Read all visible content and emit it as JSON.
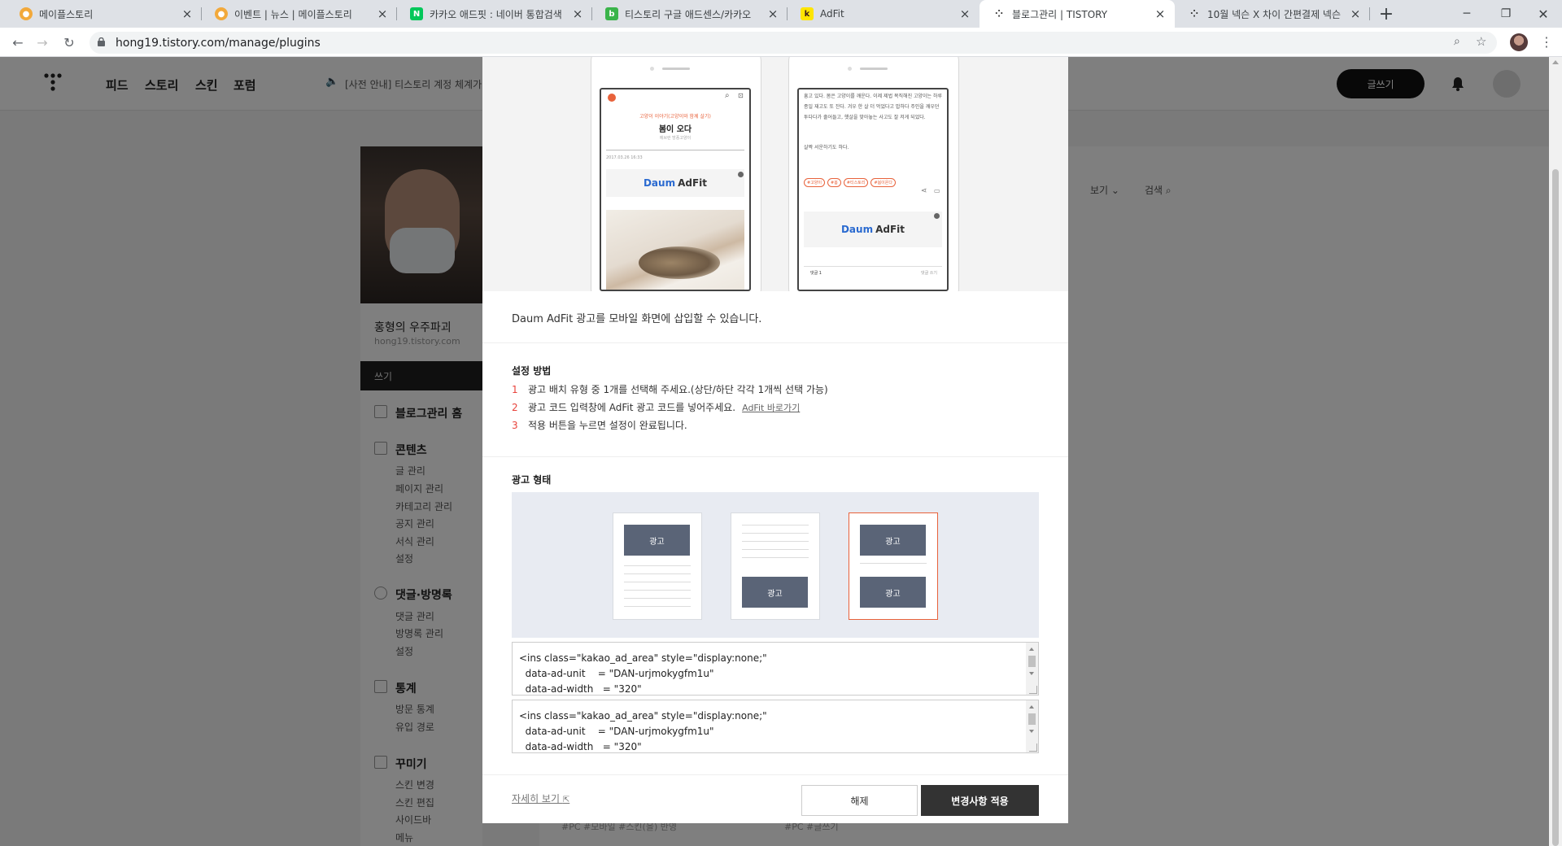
{
  "browser": {
    "tabs": [
      {
        "title": "메이플스토리",
        "favicon": "maple-icon"
      },
      {
        "title": "이벤트 | 뉴스 | 메이플스토리",
        "favicon": "maple-icon"
      },
      {
        "title": "카카오 애드핏 : 네이버 통합검색",
        "favicon": "naver-icon"
      },
      {
        "title": "티스토리 구글 애드센스/카카오",
        "favicon": "blog-icon"
      },
      {
        "title": "AdFit",
        "favicon": "kakao-icon"
      },
      {
        "title": "블로그관리 | TISTORY",
        "favicon": "tistory-icon"
      },
      {
        "title": "10월 넥슨 X 차이 간편결제 넥슨",
        "favicon": "tistory-icon"
      }
    ],
    "url": "hong19.tistory.com/manage/plugins"
  },
  "gnb": {
    "nav": [
      "피드",
      "스토리",
      "스킨",
      "포럼"
    ],
    "notice": "[사전 안내] 티스토리 계정 체계가 카",
    "write_button": "글쓰기"
  },
  "sidebar": {
    "blog_name": "홍형의 우주파괴",
    "blog_url": "hong19.tistory.com",
    "write": "쓰기",
    "home": "블로그관리 홈",
    "sections": [
      {
        "title": "콘텐츠",
        "items": [
          "글 관리",
          "페이지 관리",
          "카테고리 관리",
          "공지 관리",
          "서식 관리",
          "설정"
        ]
      },
      {
        "title": "댓글·방명록",
        "items": [
          "댓글 관리",
          "방명록 관리",
          "설정"
        ]
      },
      {
        "title": "통계",
        "items": [
          "방문 통계",
          "유입 경로"
        ]
      },
      {
        "title": "꾸미기",
        "items": [
          "스킨 변경",
          "스킨 편집",
          "사이드바",
          "메뉴"
        ]
      }
    ]
  },
  "content": {
    "view_label": "보기",
    "search_label": "검색",
    "card_tags": [
      "#PC  #모바일  #스킨(을) 반영",
      "#PC  #글쓰기"
    ]
  },
  "modal": {
    "preview": {
      "left_tagline": "고양이 이야기(고양이와 함께 살기)",
      "left_title": "봄이 오다",
      "left_sub": "에브런 방풍고양이",
      "left_date": "2017.03.26  16:33",
      "adfit_label": "AdFit",
      "right_text": "흥고 있다. 봄은 고양이를 깨운다. 이제 제법 목직해진 고양이는 하루 종일 재고도 또 잔다. 겨우 한 살 더 먹었다고 밥하다 주인을 깨우던 투다다가 줄어들고, 햇살을 맞아놓는 사고도 잘 저게 되었다.",
      "right_text2": "살짝 서운하기도 하다.",
      "right_tags": [
        "#고양이",
        "#봄",
        "#티스토리",
        "#봄이온다"
      ],
      "right_comment": "댓글 1",
      "right_comment_write": "댓글 쓰기"
    },
    "description": "Daum AdFit 광고를 모바일 화면에 삽입할 수 있습니다.",
    "setup_title": "설정 방법",
    "steps": [
      {
        "num": "1",
        "text": "광고 배치 유형 중 1개를 선택해 주세요.(상단/하단 각각 1개씩 선택 가능)"
      },
      {
        "num": "2",
        "text": "광고 코드 입력창에 AdFit 광고 코드를 넣어주세요.",
        "link": "AdFit 바로가기"
      },
      {
        "num": "3",
        "text": "적용 버튼을 누르면 설정이 완료됩니다."
      }
    ],
    "ad_type_title": "광고 형태",
    "ad_label": "광고",
    "selected_type": 3,
    "code_top": "<ins class=\"kakao_ad_area\" style=\"display:none;\"\n  data-ad-unit    = \"DAN-urjmokygfm1u\"\n  data-ad-width   = \"320\"",
    "code_bottom": "<ins class=\"kakao_ad_area\" style=\"display:none;\"\n  data-ad-unit    = \"DAN-urjmokygfm1u\"\n  data-ad-width   = \"320\"",
    "more_link": "자세히 보기",
    "cancel_button": "해제",
    "apply_button": "변경사항 적용",
    "accent": "#e8623b"
  }
}
